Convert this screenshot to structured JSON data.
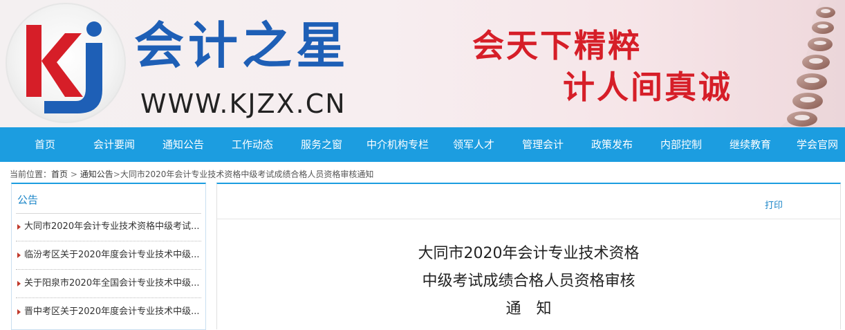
{
  "header": {
    "logo_letters": "kj",
    "brand_name": "会计之星",
    "url": "WWW.KJZX.CN",
    "slogan_line1": "会天下精粹",
    "slogan_line2": "计人间真诚",
    "colors": {
      "brand_blue": "#1e5fb6",
      "brand_red": "#d61e28",
      "nav_blue": "#1c9de0"
    }
  },
  "nav": {
    "items": [
      {
        "label": "首页"
      },
      {
        "label": "会计要闻"
      },
      {
        "label": "通知公告"
      },
      {
        "label": "工作动态"
      },
      {
        "label": "服务之窗"
      },
      {
        "label": "中介机构专栏"
      },
      {
        "label": "领军人才"
      },
      {
        "label": "管理会计"
      },
      {
        "label": "政策发布"
      },
      {
        "label": "内部控制"
      },
      {
        "label": "继续教育"
      },
      {
        "label": "学会官网"
      }
    ]
  },
  "breadcrumb": {
    "prefix": "当前位置：",
    "home": "首页",
    "section": "通知公告",
    "current": "大同市2020年会计专业技术资格中级考试成绩合格人员资格审核通知",
    "sep": ">"
  },
  "sidebar": {
    "title": "公告",
    "items": [
      {
        "label": "大同市2020年会计专业技术资格中级考试..."
      },
      {
        "label": "临汾考区关于2020年度会计专业技术中级..."
      },
      {
        "label": "关于阳泉市2020年全国会计专业技术中级..."
      },
      {
        "label": "晋中考区关于2020年度会计专业技术中级..."
      }
    ]
  },
  "article": {
    "print_label": "打印",
    "title_line1": "大同市2020年会计专业技术资格",
    "title_line2": "中级考试成绩合格人员资格审核",
    "title_line3": "通　知"
  }
}
